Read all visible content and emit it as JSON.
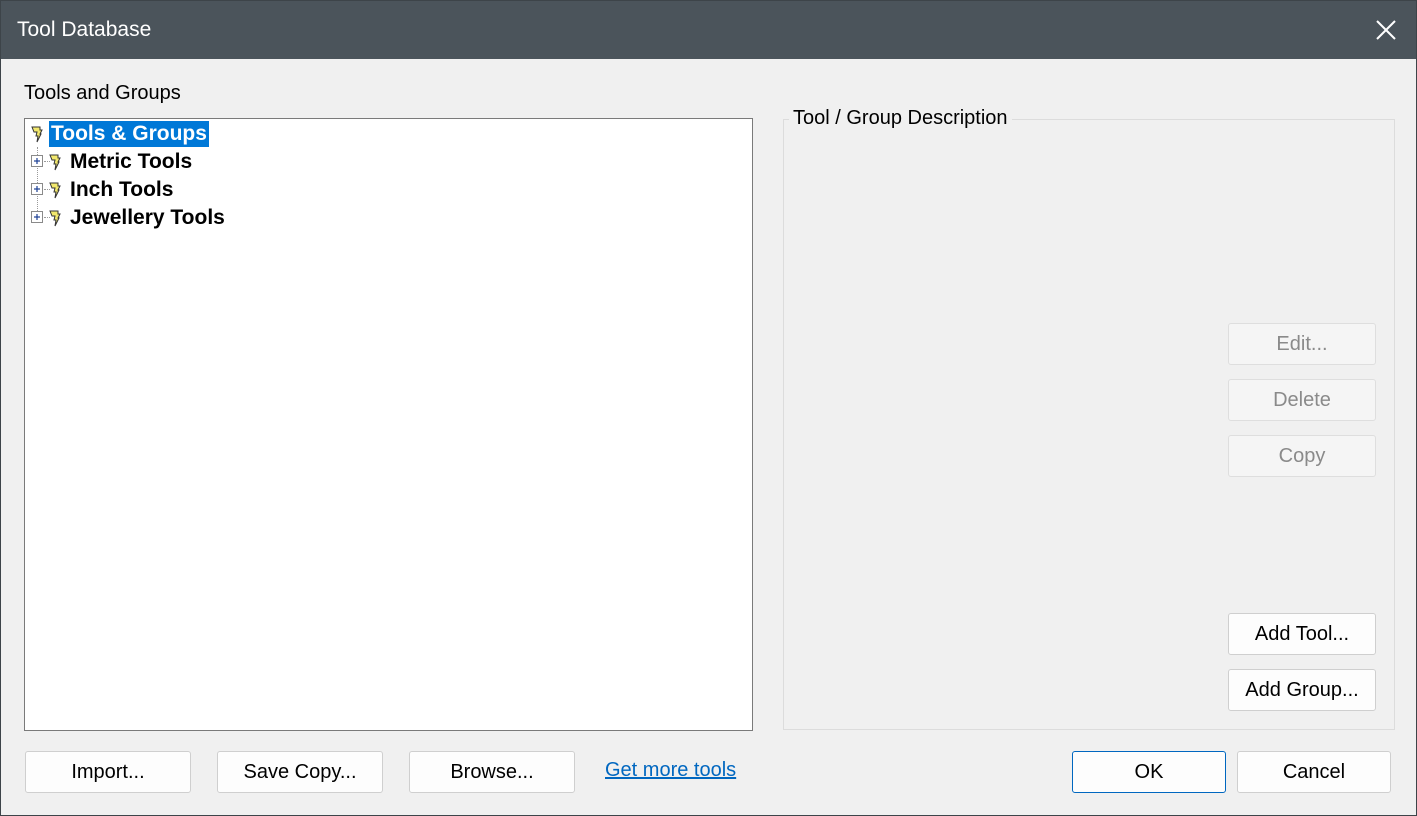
{
  "window": {
    "title": "Tool Database"
  },
  "left_panel": {
    "label": "Tools and Groups",
    "tree": {
      "root": {
        "label": "Tools & Groups",
        "icon": "tool-group-icon",
        "selected": true
      },
      "children": [
        {
          "label": "Metric Tools",
          "icon": "tool-group-icon",
          "expandable": true
        },
        {
          "label": "Inch Tools",
          "icon": "tool-group-icon",
          "expandable": true
        },
        {
          "label": "Jewellery Tools",
          "icon": "tool-group-icon",
          "expandable": true
        }
      ]
    }
  },
  "right_panel": {
    "group_title": "Tool / Group Description",
    "buttons": {
      "edit": {
        "label": "Edit...",
        "enabled": false
      },
      "delete": {
        "label": "Delete",
        "enabled": false
      },
      "copy": {
        "label": "Copy",
        "enabled": false
      },
      "add_tool": {
        "label": "Add Tool...",
        "enabled": true
      },
      "add_group": {
        "label": "Add Group...",
        "enabled": true
      }
    }
  },
  "footer": {
    "import": "Import...",
    "save_copy": "Save Copy...",
    "browse": "Browse...",
    "get_more_link": "Get more tools",
    "ok": "OK",
    "cancel": "Cancel"
  },
  "colors": {
    "titlebar": "#4b545b",
    "selection": "#0078d7",
    "link": "#0067c0"
  }
}
